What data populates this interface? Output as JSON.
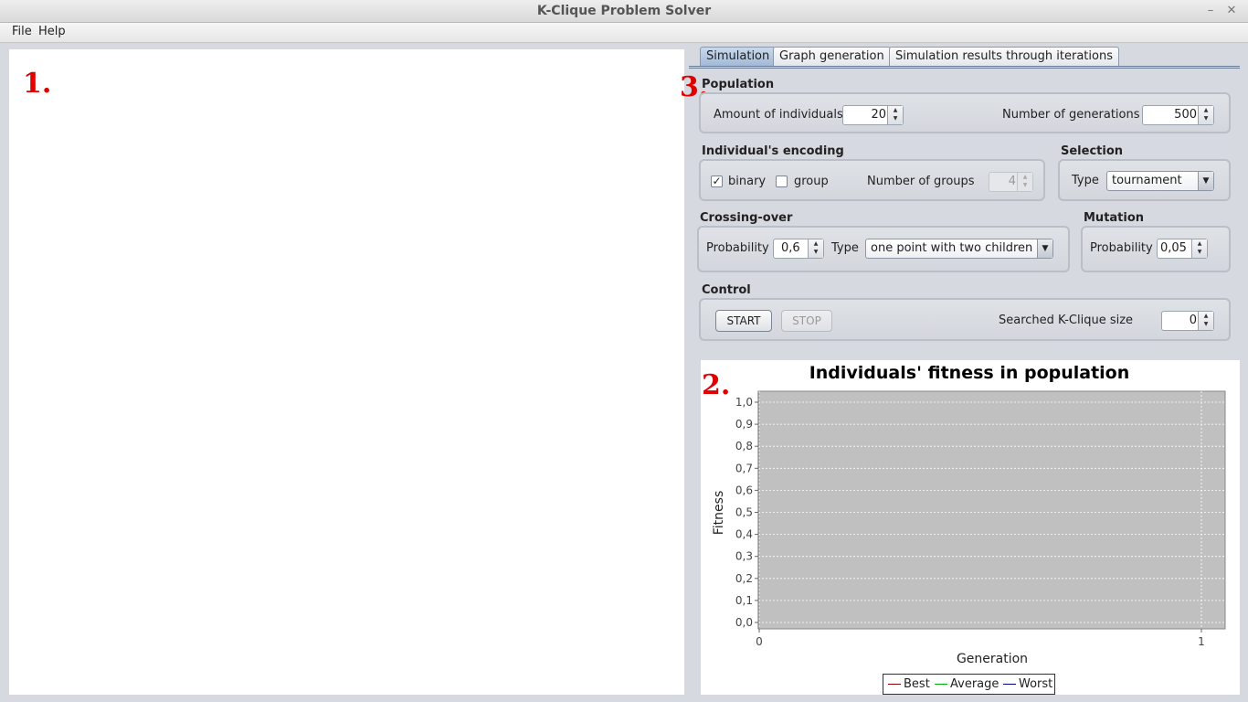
{
  "window": {
    "title": "K-Clique Problem Solver"
  },
  "menubar": {
    "file": "File",
    "help": "Help"
  },
  "markers": {
    "graph": "1.",
    "chart": "2.",
    "settings": "3."
  },
  "tabs": [
    "Simulation",
    "Graph generation",
    "Simulation results through iterations"
  ],
  "population": {
    "title": "Population",
    "amount_label": "Amount of individuals",
    "amount_value": "20",
    "generations_label": "Number of generations",
    "generations_value": "500"
  },
  "encoding": {
    "title": "Individual's encoding",
    "binary_label": "binary",
    "binary_checked": true,
    "group_label": "group",
    "group_checked": false,
    "groups_label": "Number of groups",
    "groups_value": "4"
  },
  "selection": {
    "title": "Selection",
    "type_label": "Type",
    "type_value": "tournament"
  },
  "crossover": {
    "title": "Crossing-over",
    "prob_label": "Probability",
    "prob_value": "0,6",
    "type_label": "Type",
    "type_value": "one point with two children"
  },
  "mutation": {
    "title": "Mutation",
    "prob_label": "Probability",
    "prob_value": "0,05"
  },
  "control": {
    "title": "Control",
    "start_label": "START",
    "stop_label": "STOP",
    "kclique_label": "Searched K-Clique size",
    "kclique_value": "0"
  },
  "chart_data": {
    "type": "line",
    "title": "Individuals' fitness in population",
    "xlabel": "Generation",
    "ylabel": "Fitness",
    "xlim": [
      0,
      1
    ],
    "ylim": [
      0,
      1
    ],
    "x_ticks": [
      "0",
      "1"
    ],
    "y_ticks": [
      "0,0",
      "0,1",
      "0,2",
      "0,3",
      "0,4",
      "0,5",
      "0,6",
      "0,7",
      "0,8",
      "0,9",
      "1,0"
    ],
    "grid": true,
    "plot_background": "#c0c0c0",
    "legend_position": "bottom",
    "series": [
      {
        "name": "Best",
        "color": "#8b0000",
        "values": []
      },
      {
        "name": "Average",
        "color": "#00b000",
        "values": []
      },
      {
        "name": "Worst",
        "color": "#000080",
        "values": []
      }
    ]
  }
}
